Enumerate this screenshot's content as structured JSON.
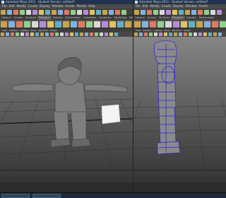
{
  "left_window": {
    "title": "Autodesk Maya 2011 - Student Version: untitled*",
    "menus": [
      "File",
      "Edit",
      "Modify",
      "Create",
      "Display",
      "Window",
      "Assets",
      "Muscle",
      "Help"
    ],
    "shelf_tabs": [
      "General",
      "Curves",
      "Surfaces",
      "Polygons",
      "Subdivs",
      "Deformation",
      "Animation",
      "Dynamics",
      "Rendering",
      "PaintEffects",
      "Toon",
      "Muscle",
      "Fluids",
      "Fur",
      "Hair",
      "nCloth",
      "Custom"
    ],
    "viewport_menus": [
      "View",
      "Shading",
      "Lighting",
      "Show",
      "Renderer",
      "Panels"
    ]
  },
  "right_window": {
    "title": "Autodesk Maya 2011 - Student Version: untitled*",
    "menus": [
      "File",
      "Edit",
      "Modify",
      "Create",
      "Display",
      "Window",
      "Assets"
    ],
    "shelf_tabs": [
      "General",
      "Curves",
      "Surfaces",
      "Polygons",
      "Subdivs",
      "Deformation"
    ],
    "viewport_menus": [
      "View",
      "Shading",
      "Lighting",
      "Show",
      "Renderer",
      "Panels"
    ]
  },
  "colors": {
    "title_bar": "#20324f",
    "wireframe": "#2a1fd6",
    "image_plane": "#f4f4f4",
    "shelf_icons": [
      "#c9a24a",
      "#7fb2e0",
      "#e07a5f",
      "#8fd18a",
      "#d8d8d8",
      "#b98ad8",
      "#e0c45f",
      "#5fb0c4"
    ]
  },
  "icons": [
    "app-icon",
    "shelf-icon",
    "status-icon",
    "viewport-icon"
  ]
}
